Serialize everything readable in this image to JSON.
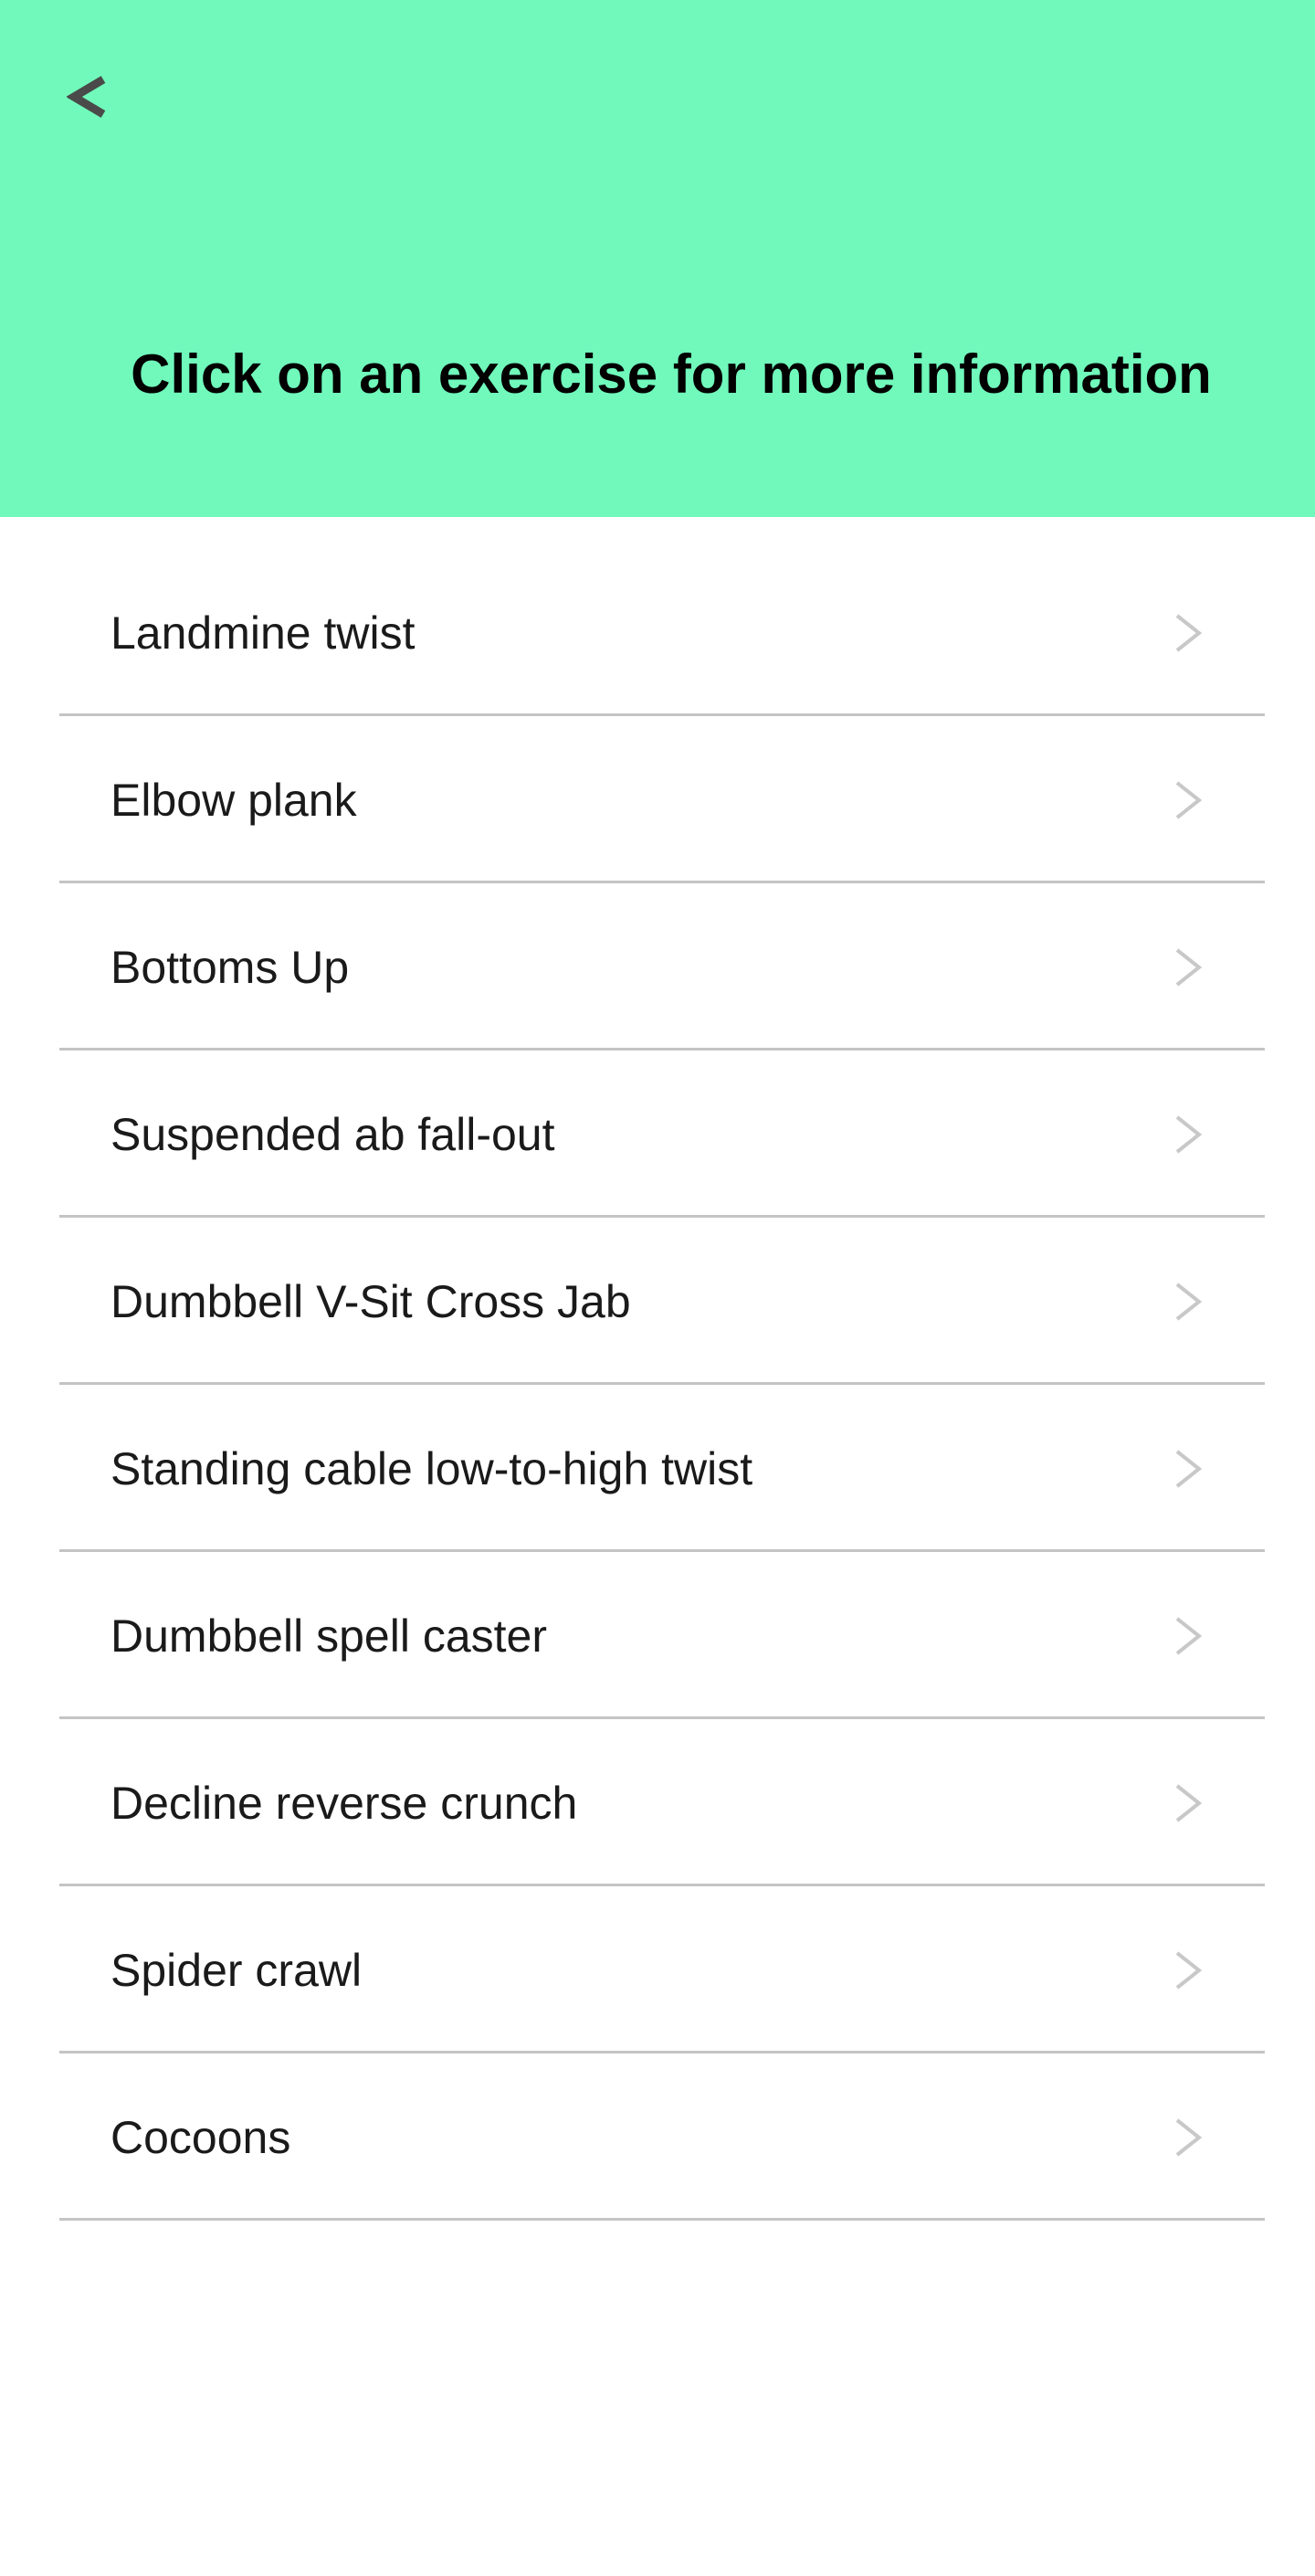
{
  "header": {
    "background": "#70f9bb",
    "back_icon": "chevron-left-icon",
    "title": "Click on an exercise for more information"
  },
  "exercises": [
    {
      "label": "Landmine twist"
    },
    {
      "label": "Elbow plank"
    },
    {
      "label": "Bottoms Up"
    },
    {
      "label": "Suspended ab fall-out"
    },
    {
      "label": "Dumbbell V-Sit Cross Jab"
    },
    {
      "label": "Standing cable low-to-high twist"
    },
    {
      "label": "Dumbbell spell caster"
    },
    {
      "label": "Decline reverse crunch"
    },
    {
      "label": "Spider crawl"
    },
    {
      "label": "Cocoons"
    }
  ],
  "item_icon": "chevron-right-icon"
}
